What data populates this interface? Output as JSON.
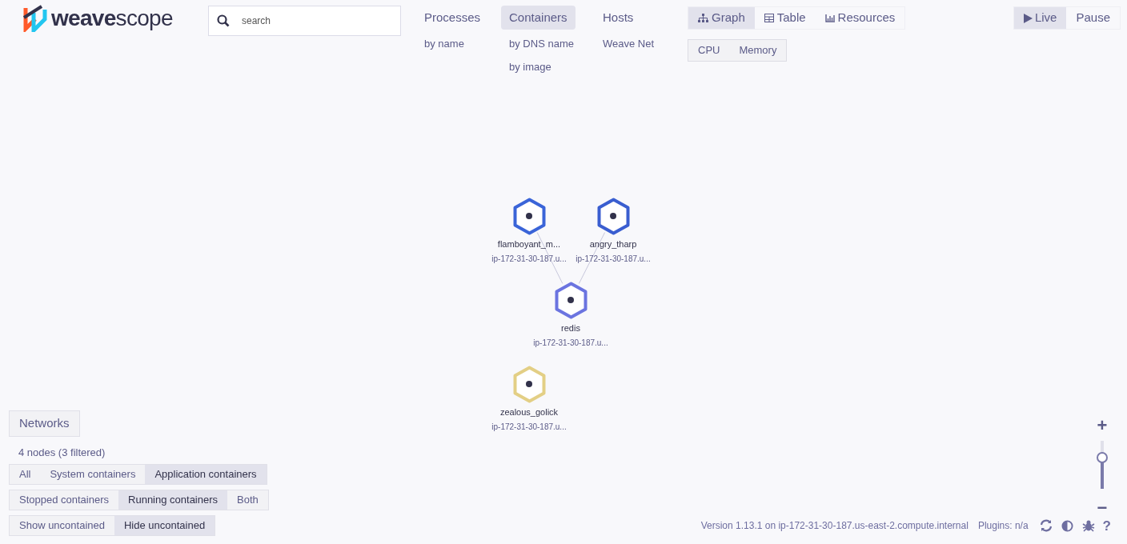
{
  "logo": {
    "bold": "weave",
    "light": "scope"
  },
  "search": {
    "placeholder": "search"
  },
  "topologies": [
    {
      "label": "Processes",
      "selected": false,
      "sub_topologies": [
        {
          "label": "by name",
          "selected": false
        }
      ]
    },
    {
      "label": "Containers",
      "selected": true,
      "sub_topologies": [
        {
          "label": "by DNS name",
          "selected": false
        },
        {
          "label": "by image",
          "selected": false
        }
      ]
    },
    {
      "label": "Hosts",
      "selected": false,
      "sub_topologies": [
        {
          "label": "Weave Net",
          "selected": false
        }
      ]
    }
  ],
  "view_modes": [
    {
      "kind": "graph",
      "label": "Graph",
      "selected": true
    },
    {
      "kind": "table",
      "label": "Table",
      "selected": false
    },
    {
      "kind": "resources",
      "label": "Resources",
      "selected": false
    }
  ],
  "metrics": [
    {
      "label": "CPU",
      "selected": false
    },
    {
      "label": "Memory",
      "selected": false
    }
  ],
  "time_control": [
    {
      "kind": "live",
      "label": "Live",
      "selected": true
    },
    {
      "kind": "pause",
      "label": "Pause",
      "selected": false
    }
  ],
  "graph": {
    "nodes": [
      {
        "kind": "client",
        "label": "flamboyant_m...",
        "sublabel": "ip-172-31-30-187.u...",
        "color": "#3a64d8"
      },
      {
        "kind": "client",
        "label": "angry_tharp",
        "sublabel": "ip-172-31-30-187.u...",
        "color": "#3a5ed0"
      },
      {
        "kind": "server",
        "label": "redis",
        "sublabel": "ip-172-31-30-187.u...",
        "color": "#6b74e0"
      },
      {
        "kind": "standalone",
        "label": "zealous_golick",
        "sublabel": "ip-172-31-30-187.u...",
        "color": "#e3cf85"
      }
    ]
  },
  "networks_button": "Networks",
  "node_count": "4 nodes (3 filtered)",
  "filter_groups": [
    [
      {
        "label": "All",
        "selected": false
      },
      {
        "label": "System containers",
        "selected": false
      },
      {
        "label": "Application containers",
        "selected": true
      }
    ],
    [
      {
        "label": "Stopped containers",
        "selected": false
      },
      {
        "label": "Running containers",
        "selected": true
      },
      {
        "label": "Both",
        "selected": false
      }
    ],
    [
      {
        "label": "Show uncontained",
        "selected": false
      },
      {
        "label": "Hide uncontained",
        "selected": true
      }
    ]
  ],
  "zoom": {
    "plus": "+",
    "minus": "−",
    "level": 0.65
  },
  "footer": {
    "version": "Version 1.13.1 on ip-172-31-30-187.us-east-2.compute.internal",
    "plugins": "Plugins: n/a",
    "help": "?"
  }
}
